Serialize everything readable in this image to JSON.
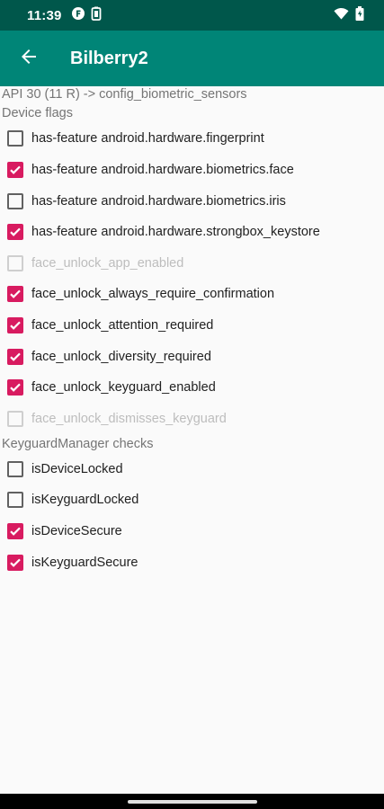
{
  "status_bar": {
    "time": "11:39",
    "left_icons": [
      "notification-f-icon",
      "battery-saver-icon"
    ],
    "right_icons": [
      "wifi-icon",
      "battery-icon"
    ]
  },
  "app_bar": {
    "title": "Bilberry2",
    "back_icon": "arrow-back-icon",
    "color": "#008577",
    "status_color": "#00574b"
  },
  "api_line": "API 30 (11 R) -> config_biometric_sensors",
  "sections": [
    {
      "header": "Device flags",
      "items": [
        {
          "label": "has-feature android.hardware.fingerprint",
          "checked": false,
          "enabled": true
        },
        {
          "label": "has-feature android.hardware.biometrics.face",
          "checked": true,
          "enabled": true
        },
        {
          "label": "has-feature android.hardware.biometrics.iris",
          "checked": false,
          "enabled": true
        },
        {
          "label": "has-feature android.hardware.strongbox_keystore",
          "checked": true,
          "enabled": true
        },
        {
          "label": "face_unlock_app_enabled",
          "checked": false,
          "enabled": false
        },
        {
          "label": "face_unlock_always_require_confirmation",
          "checked": true,
          "enabled": true
        },
        {
          "label": "face_unlock_attention_required",
          "checked": true,
          "enabled": true
        },
        {
          "label": "face_unlock_diversity_required",
          "checked": true,
          "enabled": true
        },
        {
          "label": "face_unlock_keyguard_enabled",
          "checked": true,
          "enabled": true
        },
        {
          "label": "face_unlock_dismisses_keyguard",
          "checked": false,
          "enabled": false
        }
      ]
    },
    {
      "header": "KeyguardManager checks",
      "items": [
        {
          "label": "isDeviceLocked",
          "checked": false,
          "enabled": true
        },
        {
          "label": "isKeyguardLocked",
          "checked": false,
          "enabled": true
        },
        {
          "label": "isDeviceSecure",
          "checked": true,
          "enabled": true
        },
        {
          "label": "isKeyguardSecure",
          "checked": true,
          "enabled": true
        }
      ]
    }
  ],
  "accent_color": "#d81b60"
}
